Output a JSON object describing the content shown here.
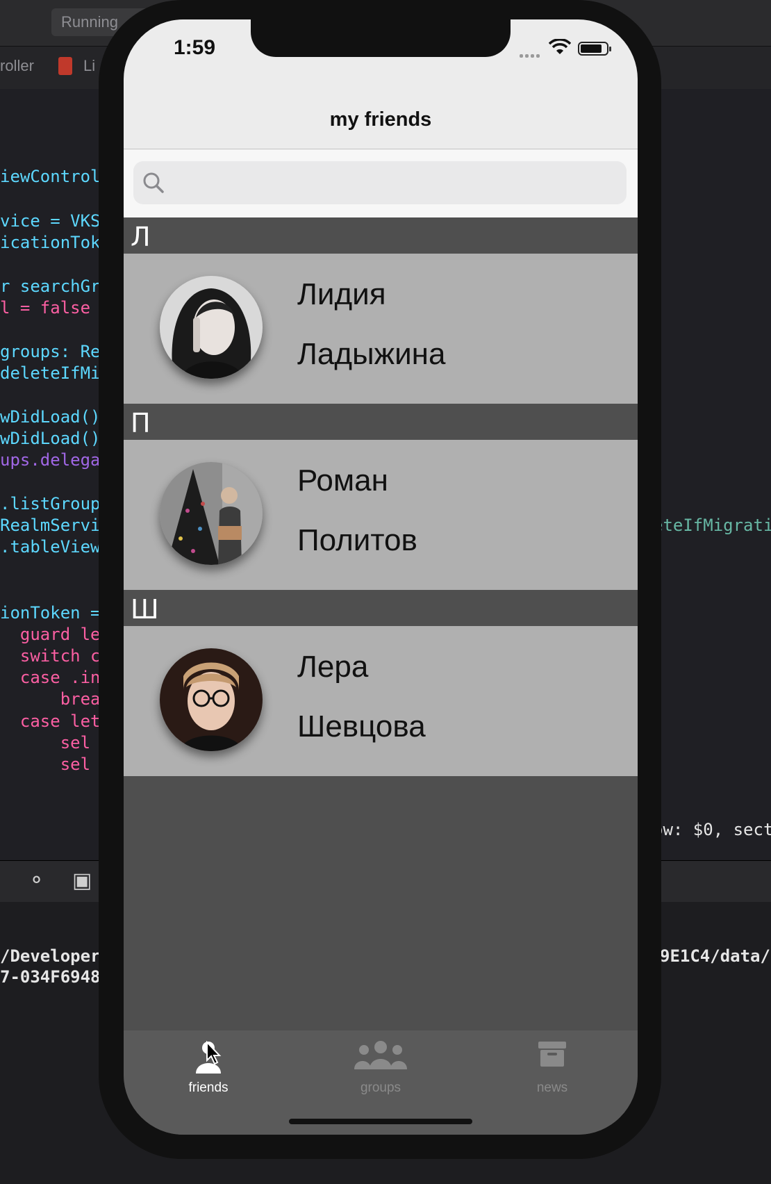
{
  "xcode": {
    "run_status": "Running",
    "breadcrumb_1": "roller",
    "breadcrumb_2": "Li",
    "code_left": [
      "iewControl",
      "vice = VKS",
      "icationTok",
      "r searchGr",
      "l = false",
      "groups: Re",
      "deleteIfMi",
      "wDidLoad()",
      "wDidLoad()",
      "ups.delega",
      ".listGroup",
      "RealmServi",
      ".tableView",
      "ionToken =",
      "  guard le",
      "  switch c",
      "  case .in",
      "      brea",
      "  case let",
      "      sel",
      "      sel"
    ],
    "code_right_1": "eteIfMigrati",
    "code_right_2": "ow: $0, sect",
    "console_left_1": "/Developer",
    "console_left_2": "7-034F6948",
    "console_right_1": "9E1C4/data/"
  },
  "status": {
    "time": "1:59"
  },
  "nav": {
    "title": "my friends"
  },
  "search": {
    "placeholder": "",
    "value": ""
  },
  "sections": [
    {
      "letter": "Л",
      "friends": [
        {
          "first": "Лидия",
          "last": "Ладыжина"
        }
      ]
    },
    {
      "letter": "П",
      "friends": [
        {
          "first": "Роман",
          "last": "Политов"
        }
      ]
    },
    {
      "letter": "Ш",
      "friends": [
        {
          "first": "Лера",
          "last": "Шевцова"
        }
      ]
    }
  ],
  "tabs": [
    {
      "label": "friends",
      "icon": "person-icon",
      "active": true
    },
    {
      "label": "groups",
      "icon": "people-icon",
      "active": false
    },
    {
      "label": "news",
      "icon": "archive-box-icon",
      "active": false
    }
  ],
  "colors": {
    "row_bg": "#b0b0b0",
    "section_bg": "#4f4f4f",
    "tabbar_bg": "#5a5a5a",
    "nav_bg": "#ececec"
  }
}
